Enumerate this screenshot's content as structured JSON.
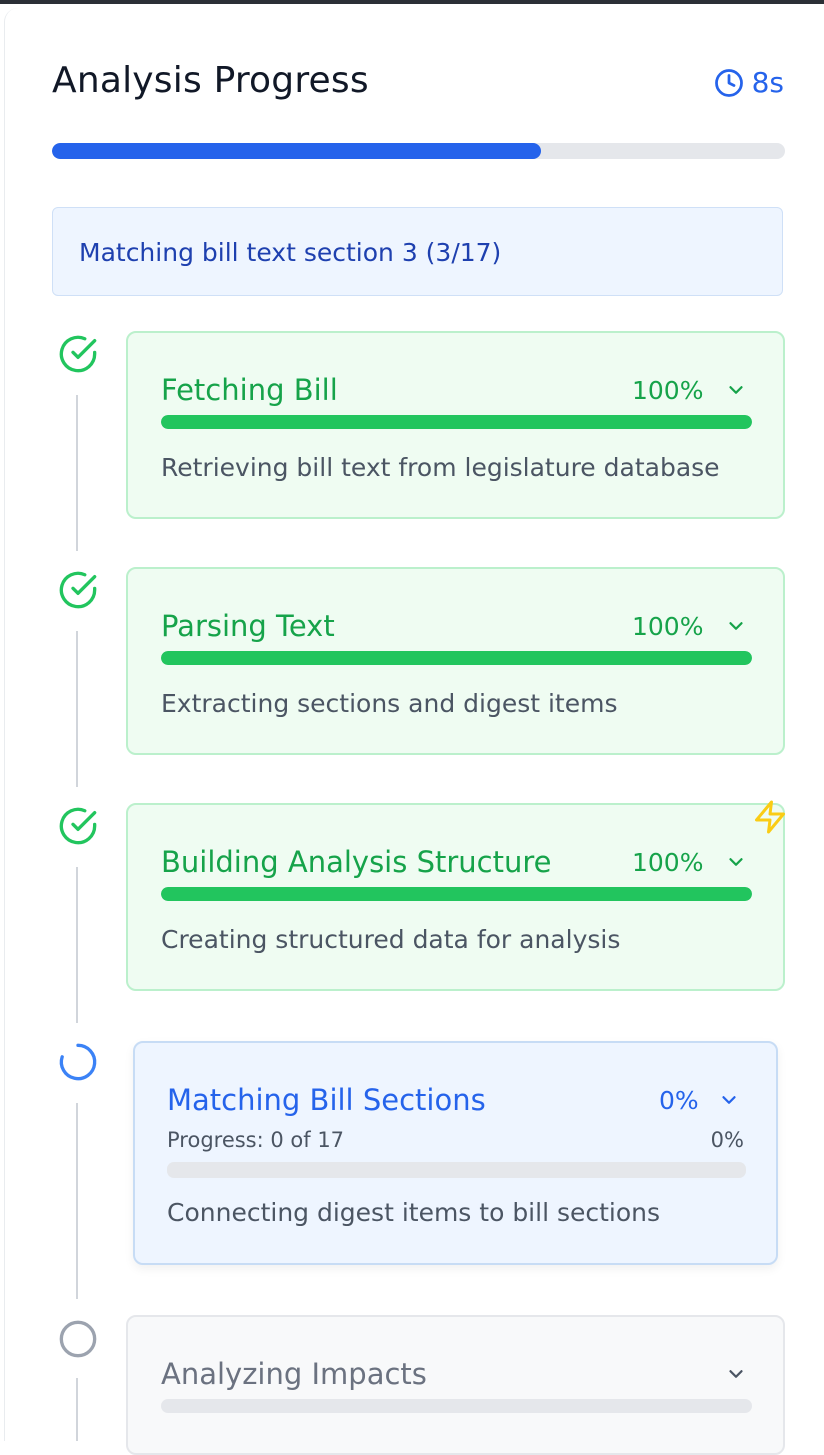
{
  "header": {
    "title": "Analysis Progress",
    "timer": "8s"
  },
  "overall_progress": 0.667,
  "status_message": "Matching bill text section 3 (3/17)",
  "steps": [
    {
      "title": "Fetching Bill",
      "percent": "100%",
      "progress": 1.0,
      "description": "Retrieving bill text from legislature database",
      "state": "complete"
    },
    {
      "title": "Parsing Text",
      "percent": "100%",
      "progress": 1.0,
      "description": "Extracting sections and digest items",
      "state": "complete"
    },
    {
      "title": "Building Analysis Structure",
      "percent": "100%",
      "progress": 1.0,
      "description": "Creating structured data for analysis",
      "state": "complete"
    },
    {
      "title": "Matching Bill Sections",
      "percent": "0%",
      "progress": 0.0,
      "sub_progress_label": "Progress: 0 of 17",
      "sub_progress_percent": "0%",
      "description": "Connecting digest items to bill sections",
      "state": "in-progress"
    },
    {
      "title": "Analyzing Impacts",
      "progress": 0.0,
      "state": "pending"
    }
  ],
  "colors": {
    "accent_blue": "#2563eb",
    "success_green": "#16a34a",
    "bar_green": "#22c55e",
    "pending_gray": "#9ca3af",
    "bolt_yellow": "#facc15"
  },
  "icons": [
    "clock-icon",
    "check-circle-icon",
    "spinner-icon",
    "pending-circle-icon",
    "chevron-down-icon",
    "lightning-icon"
  ]
}
